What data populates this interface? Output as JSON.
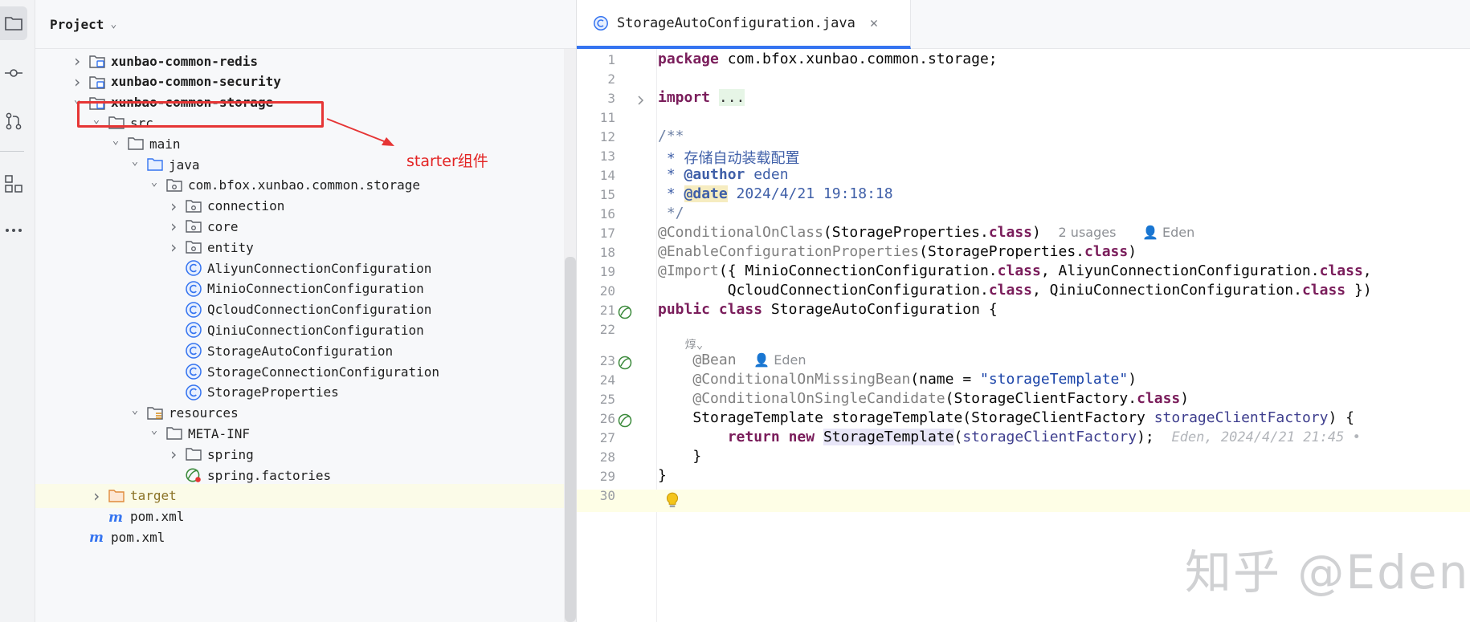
{
  "project_panel": {
    "title": "Project",
    "tree": [
      {
        "label": "xunbao-common-redis",
        "depth": 0,
        "expanded": false,
        "icon": "module-folder-icon",
        "bold": true
      },
      {
        "label": "xunbao-common-security",
        "depth": 0,
        "expanded": false,
        "icon": "module-folder-icon",
        "bold": true
      },
      {
        "label": "xunbao-common-storage",
        "depth": 0,
        "expanded": true,
        "icon": "module-folder-icon",
        "bold": true
      },
      {
        "label": "src",
        "depth": 1,
        "expanded": true,
        "icon": "folder-icon"
      },
      {
        "label": "main",
        "depth": 2,
        "expanded": true,
        "icon": "folder-icon"
      },
      {
        "label": "java",
        "depth": 3,
        "expanded": true,
        "icon": "source-folder-icon"
      },
      {
        "label": "com.bfox.xunbao.common.storage",
        "depth": 4,
        "expanded": true,
        "icon": "package-icon"
      },
      {
        "label": "connection",
        "depth": 5,
        "expanded": false,
        "icon": "package-icon"
      },
      {
        "label": "core",
        "depth": 5,
        "expanded": false,
        "icon": "package-icon"
      },
      {
        "label": "entity",
        "depth": 5,
        "expanded": false,
        "icon": "package-icon"
      },
      {
        "label": "AliyunConnectionConfiguration",
        "depth": 5,
        "icon": "java-class-icon"
      },
      {
        "label": "MinioConnectionConfiguration",
        "depth": 5,
        "icon": "java-class-icon"
      },
      {
        "label": "QcloudConnectionConfiguration",
        "depth": 5,
        "icon": "java-class-icon"
      },
      {
        "label": "QiniuConnectionConfiguration",
        "depth": 5,
        "icon": "java-class-icon"
      },
      {
        "label": "StorageAutoConfiguration",
        "depth": 5,
        "icon": "java-class-icon",
        "selected": true
      },
      {
        "label": "StorageConnectionConfiguration",
        "depth": 5,
        "icon": "java-class-icon"
      },
      {
        "label": "StorageProperties",
        "depth": 5,
        "icon": "java-class-icon"
      },
      {
        "label": "resources",
        "depth": 3,
        "expanded": true,
        "icon": "resources-folder-icon"
      },
      {
        "label": "META-INF",
        "depth": 4,
        "expanded": true,
        "icon": "folder-icon"
      },
      {
        "label": "spring",
        "depth": 5,
        "expanded": false,
        "icon": "folder-icon"
      },
      {
        "label": "spring.factories",
        "depth": 5,
        "icon": "spring-factories-icon"
      },
      {
        "label": "target",
        "depth": 1,
        "expanded": false,
        "icon": "excluded-folder-icon",
        "excluded": true
      },
      {
        "label": "pom.xml",
        "depth": 1,
        "icon": "maven-icon"
      },
      {
        "label": "pom.xml",
        "depth": 0,
        "icon": "maven-icon"
      }
    ]
  },
  "annotation": {
    "text": "starter组件",
    "color": "#e32424"
  },
  "editor": {
    "tab_label": "StorageAutoConfiguration.java",
    "accent": "#3574f0",
    "line_numbers": [
      "1",
      "2",
      "3",
      "11",
      "12",
      "13",
      "14",
      "15",
      "16",
      "17",
      "18",
      "19",
      "20",
      "21",
      "22",
      "23",
      "24",
      "25",
      "26",
      "27",
      "28",
      "29",
      "30"
    ],
    "code": {
      "l1_kw": "package",
      "l1_rest": " com.bfox.xunbao.common.storage;",
      "l3_kw": "import",
      "l3_fold": "...",
      "l12": "/**",
      "l13": " * 存储自动装载配置",
      "l14_pre": " * ",
      "l14_tag": "@author",
      "l14_rest": " eden",
      "l15_pre": " * ",
      "l15_tag": "@date",
      "l15_rest": " 2024/4/21 19:18:18",
      "l16": " */",
      "l17_ann": "@ConditionalOnClass",
      "l17_a": "(StorageProperties.",
      "l17_kw": "class",
      "l17_b": ")",
      "l17_hint1": "2 usages",
      "l17_hint2": "Eden",
      "l18_ann": "@EnableConfigurationProperties",
      "l18_a": "(StorageProperties.",
      "l18_kw": "class",
      "l18_b": ")",
      "l19_ann": "@Import",
      "l19_a": "({ MinioConnectionConfiguration.",
      "l19_kw1": "class",
      "l19_b": ", AliyunConnectionConfiguration.",
      "l19_kw2": "class",
      "l19_c": ",",
      "l20_a": "        QcloudConnectionConfiguration.",
      "l20_kw1": "class",
      "l20_b": ", QiniuConnectionConfiguration.",
      "l20_kw2": "class",
      "l20_c": " })",
      "l21_kw1": "public",
      "l21_kw2": "class",
      "l21_rest": " StorageAutoConfiguration {",
      "l23_ann": "@Bean",
      "l23_hint": "Eden",
      "l24_ann": "@ConditionalOnMissingBean",
      "l24_a": "(name = ",
      "l24_str": "\"storageTemplate\"",
      "l24_b": ")",
      "l25_ann": "@ConditionalOnSingleCandidate",
      "l25_a": "(StorageClientFactory.",
      "l25_kw": "class",
      "l25_b": ")",
      "l26_a": "StorageTemplate storageTemplate(StorageClientFactory ",
      "l26_param": "storageClientFactory",
      "l26_b": ") {",
      "l27_kw1": "return",
      "l27_kw2": "new",
      "l27_type": "StorageTemplate",
      "l27_a": "(",
      "l27_param": "storageClientFactory",
      "l27_b": ");",
      "l27_ghost": "Eden, 2024/4/21 21:45 •",
      "l28": "    }",
      "l29": "}"
    }
  },
  "watermark": "知乎 @Eden"
}
